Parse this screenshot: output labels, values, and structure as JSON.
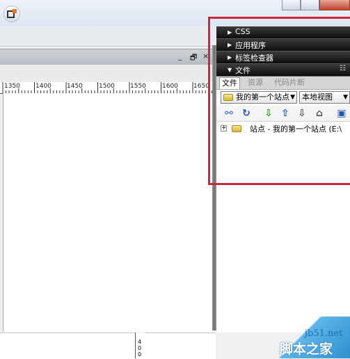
{
  "panel": {
    "headers": [
      {
        "label": "CSS",
        "expanded": false
      },
      {
        "label": "应用程序",
        "expanded": false
      },
      {
        "label": "标签检查器",
        "expanded": false
      },
      {
        "label": "文件",
        "expanded": true
      }
    ],
    "options_icon": "panel-options-icon",
    "tabs": [
      {
        "label": "文件",
        "active": true
      },
      {
        "label": "资源",
        "active": false
      },
      {
        "label": "代码片断",
        "active": false
      }
    ],
    "site_select": "我的第一个站点",
    "view_select": "本地视图",
    "toolbar_icons": [
      "connect-icon",
      "refresh-icon",
      "get-file-icon",
      "put-file-icon",
      "check-out-icon",
      "check-in-icon",
      "expand-panel-icon"
    ],
    "tree": {
      "label": "站点 - 我的第一个站点 (E:\\"
    }
  },
  "ruler": {
    "labels": [
      "1350",
      "1400",
      "1450",
      "1500",
      "1550",
      "1600",
      "1650"
    ]
  },
  "vruler": {
    "labels": [
      "4",
      "0",
      "0"
    ]
  },
  "docbar": {
    "minimize": "_",
    "restore": "🗗",
    "close": "×"
  },
  "watermark": {
    "site": "jb51.net",
    "name": "脚本之家"
  },
  "colors": {
    "highlight": "#c9283e",
    "panel_header": "#111111"
  }
}
